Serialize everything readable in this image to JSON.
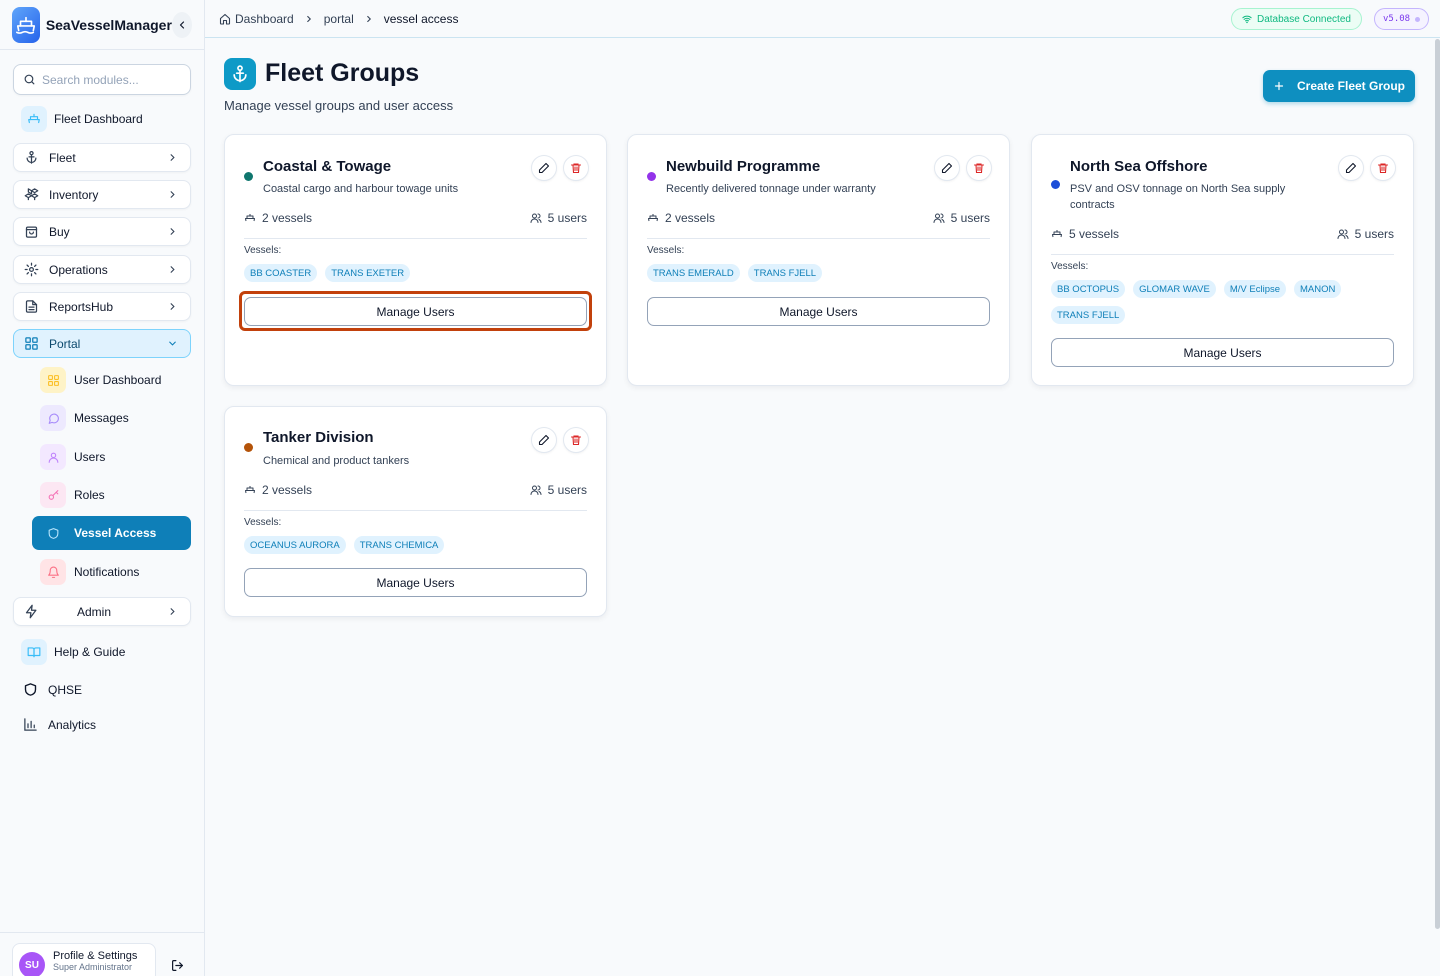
{
  "app": {
    "name": "SeaVesselManager"
  },
  "search": {
    "placeholder": "Search modules..."
  },
  "sidebar": {
    "items": [
      {
        "label": "Fleet Dashboard"
      },
      {
        "label": "Fleet"
      },
      {
        "label": "Inventory"
      },
      {
        "label": "Buy"
      },
      {
        "label": "Operations"
      },
      {
        "label": "ReportsHub"
      },
      {
        "label": "Portal"
      },
      {
        "label": "Admin"
      },
      {
        "label": "Help & Guide"
      },
      {
        "label": "QHSE"
      },
      {
        "label": "Analytics"
      }
    ],
    "portal_sub": [
      {
        "label": "User Dashboard"
      },
      {
        "label": "Messages"
      },
      {
        "label": "Users"
      },
      {
        "label": "Roles"
      },
      {
        "label": "Vessel Access"
      },
      {
        "label": "Notifications"
      }
    ]
  },
  "profile": {
    "initials": "SU",
    "name": "Profile & Settings",
    "role": "Super Administrator"
  },
  "breadcrumb": {
    "home": "Dashboard",
    "section": "portal",
    "current": "vessel access"
  },
  "status": {
    "db": "Database Connected",
    "version": "v5.08"
  },
  "page": {
    "title": "Fleet Groups",
    "subtitle": "Manage vessel groups and user access",
    "create_label": "Create Fleet Group"
  },
  "vessels_label": "Vessels:",
  "manage_label": "Manage Users",
  "colors": {
    "accent": "#0e8fc0",
    "teal": "#0f766e",
    "purple": "#9333ea",
    "blue": "#1d4ed8",
    "brown": "#b45309",
    "highlight": "#c2410c"
  },
  "groups": [
    {
      "name": "Coastal & Towage",
      "description": "Coastal cargo and harbour towage units",
      "vessels_count": "2 vessels",
      "users_count": "5 users",
      "vessels": [
        "BB COASTER",
        "TRANS EXETER"
      ]
    },
    {
      "name": "Newbuild Programme",
      "description": "Recently delivered tonnage under warranty",
      "vessels_count": "2 vessels",
      "users_count": "5 users",
      "vessels": [
        "TRANS EMERALD",
        "TRANS FJELL"
      ]
    },
    {
      "name": "North Sea Offshore",
      "description": "PSV and OSV tonnage on North Sea supply contracts",
      "vessels_count": "5 vessels",
      "users_count": "5 users",
      "vessels": [
        "BB OCTOPUS",
        "GLOMAR WAVE",
        "M/V Eclipse",
        "MANON",
        "TRANS FJELL"
      ]
    },
    {
      "name": "Tanker Division",
      "description": "Chemical and product tankers",
      "vessels_count": "2 vessels",
      "users_count": "5 users",
      "vessels": [
        "OCEANUS AURORA",
        "TRANS CHEMICA"
      ]
    }
  ]
}
